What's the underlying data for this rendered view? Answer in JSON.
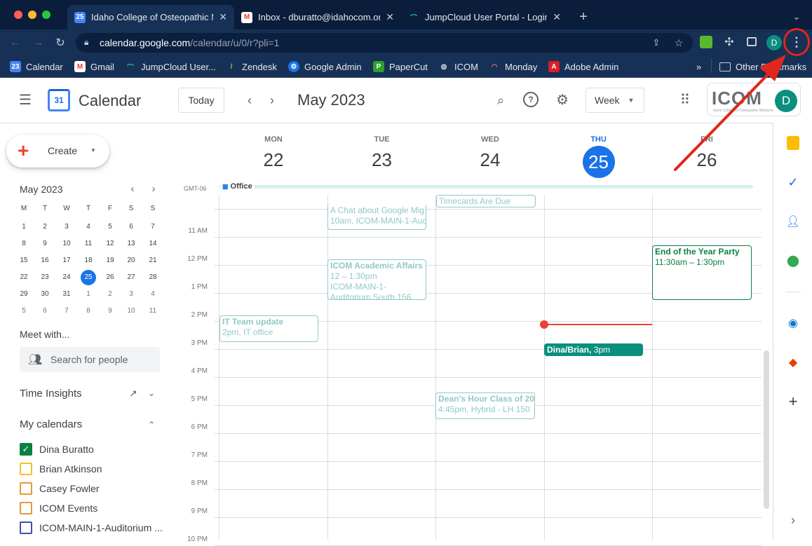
{
  "browser": {
    "tabs": [
      {
        "title": "Idaho College of Osteopathic M",
        "fav": "calendar-favicon",
        "active": true
      },
      {
        "title": "Inbox - dburatto@idahocom.or",
        "fav": "gmail-favicon",
        "active": false
      },
      {
        "title": "JumpCloud User Portal - Login",
        "fav": "jumpcloud-favicon",
        "active": false
      }
    ],
    "url_host": "calendar.google.com",
    "url_path": "/calendar/u/0/r?pli=1",
    "profile_initial": "D",
    "bookmarks": [
      "Calendar",
      "Gmail",
      "JumpCloud User...",
      "Zendesk",
      "Google Admin",
      "PaperCut",
      "ICOM",
      "Monday",
      "Adobe Admin"
    ],
    "bookmark_overflow": "»",
    "other_bookmarks": "Other Bookmarks"
  },
  "calendar": {
    "app_name": "Calendar",
    "logo_day": "31",
    "today_label": "Today",
    "current_range": "May 2023",
    "view_label": "Week",
    "org_logo_text": "ICOM",
    "org_logo_sub": "Idaho College of Osteopathic Medicine",
    "avatar_initial": "D"
  },
  "sidebar": {
    "create_label": "Create",
    "mini_month": "May 2023",
    "weekday_headers": [
      "M",
      "T",
      "W",
      "T",
      "F",
      "S",
      "S"
    ],
    "weeks": [
      [
        "1",
        "2",
        "3",
        "4",
        "5",
        "6",
        "7"
      ],
      [
        "8",
        "9",
        "10",
        "11",
        "12",
        "13",
        "14"
      ],
      [
        "15",
        "16",
        "17",
        "18",
        "19",
        "20",
        "21"
      ],
      [
        "22",
        "23",
        "24",
        "25",
        "26",
        "27",
        "28"
      ],
      [
        "29",
        "30",
        "31",
        "1",
        "2",
        "3",
        "4"
      ],
      [
        "5",
        "6",
        "7",
        "8",
        "9",
        "10",
        "11"
      ]
    ],
    "today_date": "25",
    "meet_with": "Meet with...",
    "search_people_placeholder": "Search for people",
    "time_insights": "Time Insights",
    "my_calendars": "My calendars",
    "calendars": [
      {
        "name": "Dina Buratto",
        "color": "#0b8043",
        "checked": true
      },
      {
        "name": "Brian Atkinson",
        "color": "#f6bf26",
        "checked": false
      },
      {
        "name": "Casey Fowler",
        "color": "#e39a3b",
        "checked": false
      },
      {
        "name": "ICOM Events",
        "color": "#e39a3b",
        "checked": false
      },
      {
        "name": "ICOM-MAIN-1-Auditorium ...",
        "color": "#3f51b5",
        "checked": false
      }
    ]
  },
  "week": {
    "timezone": "GMT-06",
    "days": [
      {
        "dow": "MON",
        "num": "22"
      },
      {
        "dow": "TUE",
        "num": "23"
      },
      {
        "dow": "WED",
        "num": "24"
      },
      {
        "dow": "THU",
        "num": "25",
        "today": true
      },
      {
        "dow": "FRI",
        "num": "26"
      }
    ],
    "allday_event": "Office",
    "hours": [
      "11 AM",
      "12 PM",
      "1 PM",
      "2 PM",
      "3 PM",
      "4 PM",
      "5 PM",
      "6 PM",
      "7 PM",
      "8 PM",
      "9 PM",
      "10 PM"
    ],
    "events": {
      "timecards": "Timecards Are Due",
      "chat_title": "A Chat about Google Mig",
      "chat_detail": "10am, ICOM-MAIN-1-Aud",
      "academic_title": "ICOM Academic Affairs",
      "academic_time": "12 – 1:30pm",
      "academic_loc1": "ICOM-MAIN-1-",
      "academic_loc2": "Auditorium South 156",
      "it_title": "IT Team update",
      "it_detail": "2pm, IT office",
      "party_title": "End of the Year Party",
      "party_time": "11:30am – 1:30pm",
      "dina_title": "Dina/Brian,",
      "dina_time": "3pm",
      "dean_title": "Dean's Hour Class of 202",
      "dean_detail": "4:45pm, Hybrid - LH 150"
    }
  },
  "colors": {
    "today_blue": "#1a73e8",
    "now_line": "#ea4335",
    "annotation_red": "#e1261c"
  }
}
